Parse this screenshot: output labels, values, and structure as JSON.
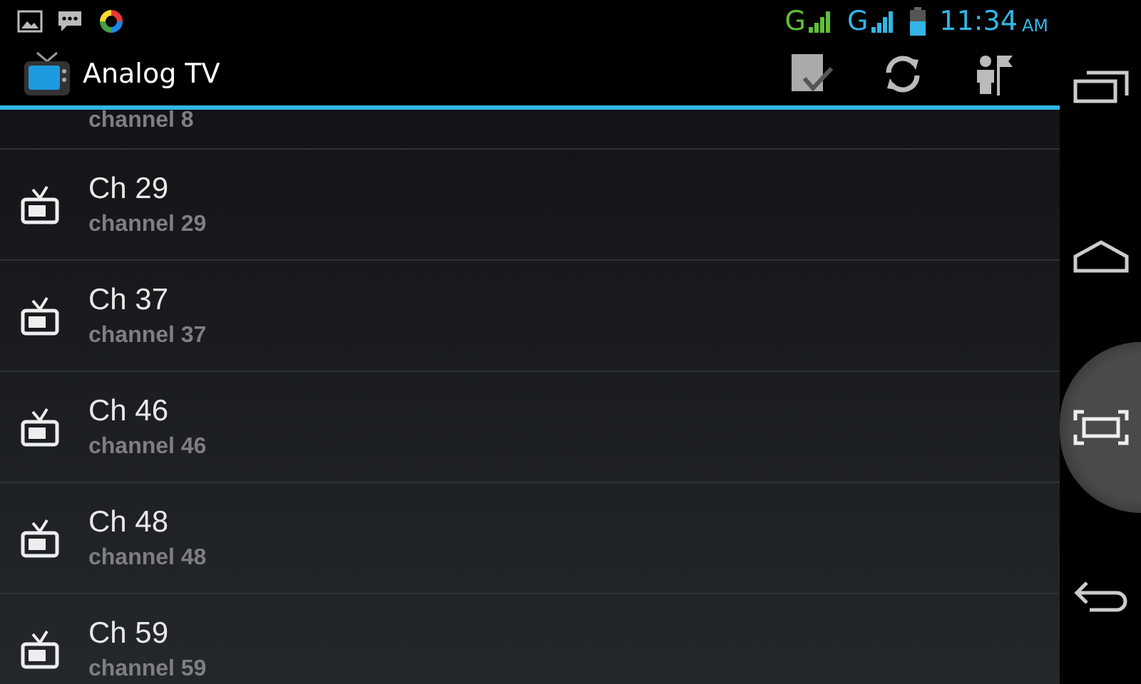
{
  "status_bar": {
    "networks": [
      {
        "label": "G",
        "color": "#5fbf3a"
      },
      {
        "label": "G",
        "color": "#33b5e5"
      }
    ],
    "time": "11:34",
    "ampm": "AM"
  },
  "action_bar": {
    "title": "Analog TV"
  },
  "channels": [
    {
      "subtitle": "channel 8"
    },
    {
      "title": "Ch 29",
      "subtitle": "channel 29"
    },
    {
      "title": "Ch 37",
      "subtitle": "channel 37"
    },
    {
      "title": "Ch 46",
      "subtitle": "channel 46"
    },
    {
      "title": "Ch 48",
      "subtitle": "channel 48"
    },
    {
      "title": "Ch 59",
      "subtitle": "channel 59"
    }
  ],
  "nav_bar": [
    {
      "kind": "recent",
      "selected": false
    },
    {
      "kind": "home",
      "selected": false
    },
    {
      "kind": "capture",
      "selected": true
    },
    {
      "kind": "back",
      "selected": false
    }
  ]
}
